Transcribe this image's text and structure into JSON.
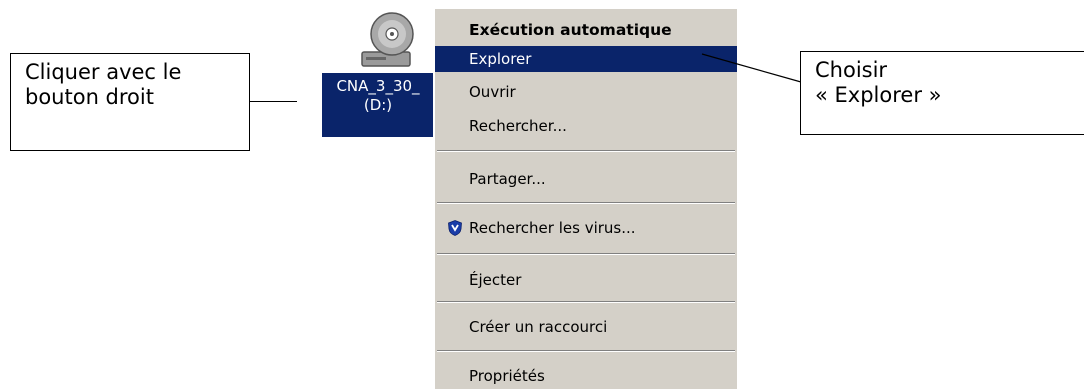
{
  "callouts": {
    "left": {
      "line1": "Cliquer avec le",
      "line2": "bouton droit"
    },
    "right": {
      "line1": "Choisir",
      "line2": "« Explorer »"
    }
  },
  "drive": {
    "label_line1": "CNA_3_30_",
    "label_line2": "(D:)",
    "icon": "cd-drive-icon"
  },
  "context_menu": {
    "items": [
      {
        "label": "Exécution automatique",
        "bold": true
      },
      {
        "label": "Explorer",
        "highlighted": true
      },
      {
        "label": "Ouvrir"
      },
      {
        "label": "Rechercher..."
      },
      {
        "label": "Partager..."
      },
      {
        "label": "Rechercher les virus...",
        "icon": "shield-icon"
      },
      {
        "label": "Éjecter"
      },
      {
        "label": "Créer un raccourci"
      },
      {
        "label": "Propriétés"
      }
    ]
  },
  "colors": {
    "menu_bg": "#d4d0c8",
    "highlight": "#0a246a",
    "highlight_text": "#ffffff"
  }
}
